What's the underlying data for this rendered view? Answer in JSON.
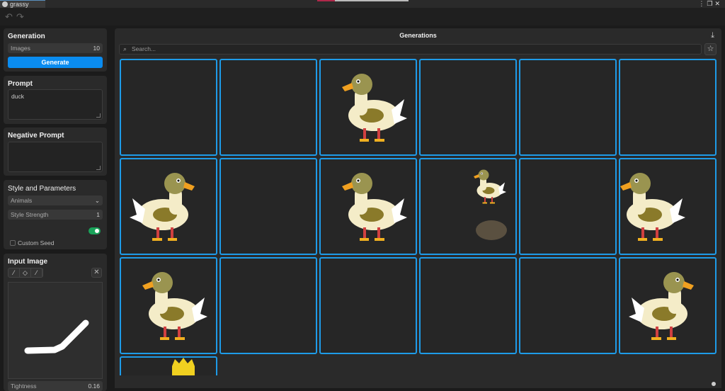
{
  "window": {
    "tab_title": "grassy ground",
    "controls": [
      "⋮",
      "❐",
      "✕"
    ]
  },
  "toolbar": {
    "undo": "↶",
    "redo": "↷"
  },
  "generation": {
    "title": "Generation",
    "images_label": "Images",
    "images_value": "10",
    "generate_label": "Generate"
  },
  "prompt": {
    "title": "Prompt",
    "value": "duck"
  },
  "negative_prompt": {
    "title": "Negative Prompt",
    "value": ""
  },
  "style": {
    "title": "Style and Parameters",
    "style_value": "Animals",
    "strength_label": "Style Strength",
    "strength_value": "1",
    "toggle_on": true,
    "custom_seed_label": "Custom Seed",
    "custom_seed_checked": false
  },
  "input_image": {
    "title": "Input Image",
    "tightness_label": "Tightness",
    "tightness_value": "0.16"
  },
  "main": {
    "title": "Generations",
    "search_placeholder": "Search..."
  },
  "colors": {
    "accent": "#0a8cf0",
    "cell_border": "#1e9be8",
    "toggle": "#1aa35a"
  }
}
